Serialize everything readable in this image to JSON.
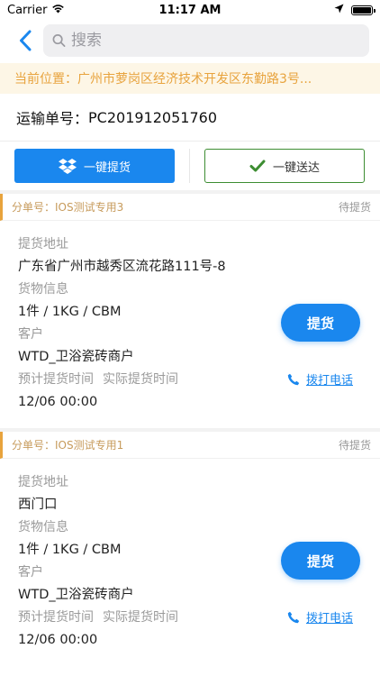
{
  "status_bar": {
    "carrier": "Carrier",
    "time": "11:17 AM",
    "battery_level": 1.0
  },
  "nav": {
    "search_placeholder": "搜索"
  },
  "location": {
    "text": "当前位置：广州市萝岗区经济技术开发区东勤路3号..."
  },
  "waybill": {
    "label": "运输单号：",
    "number": "PC201912051760"
  },
  "actions": {
    "pickup_all_label": "一键提货",
    "deliver_all_label": "一键送达"
  },
  "colors": {
    "primary": "#1a87ee",
    "accent": "#e8a33d",
    "success": "#3d8d32"
  },
  "labels": {
    "pickup_address": "提货地址",
    "goods_info": "货物信息",
    "customer": "客户",
    "planned_time": "预计提货时间",
    "actual_time": "实际提货时间",
    "pickup_button": "提货",
    "call_button": "拨打电话"
  },
  "orders": [
    {
      "sub_no": "分单号：IOS测试专用3",
      "status": "待提货",
      "address": "广东省广州市越秀区流花路111号-8",
      "goods": "1件 / 1KG / CBM",
      "customer": "WTD_卫浴瓷砖商户",
      "planned_time": "12/06 00:00"
    },
    {
      "sub_no": "分单号：IOS测试专用1",
      "status": "待提货",
      "address": "西门口",
      "goods": "1件 / 1KG / CBM",
      "customer": "WTD_卫浴瓷砖商户",
      "planned_time": "12/06 00:00"
    }
  ]
}
